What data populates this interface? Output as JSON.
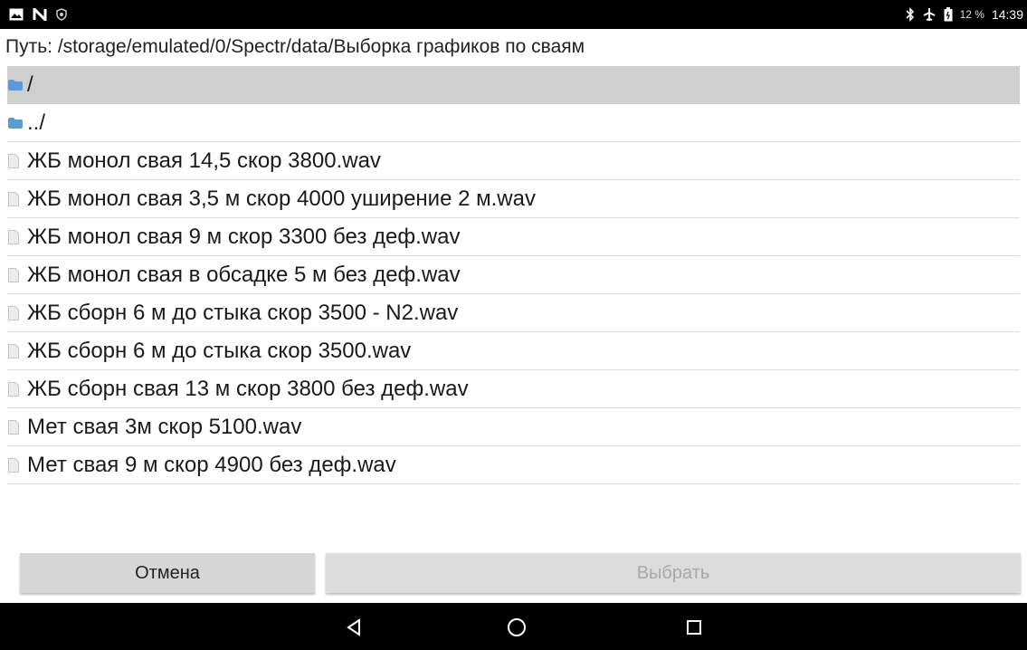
{
  "status_bar": {
    "battery_percent": "12 %",
    "time": "14:39",
    "left_icons": [
      "image-icon",
      "n-icon",
      "shield-icon"
    ],
    "right_icons": [
      "bluetooth-icon",
      "airplane-icon",
      "battery-icon"
    ]
  },
  "path_label": "Путь: /storage/emulated/0/Spectr/data/Выборка графиков по сваям",
  "items": [
    {
      "label": "/",
      "icon": "folder-icon",
      "selected": true
    },
    {
      "label": "../",
      "icon": "folder-icon",
      "selected": false
    },
    {
      "label": "ЖБ монол свая 14,5 скор 3800.wav",
      "icon": "file-icon",
      "selected": false
    },
    {
      "label": "ЖБ монол свая 3,5 м скор 4000 уширение 2 м.wav",
      "icon": "file-icon",
      "selected": false
    },
    {
      "label": "ЖБ монол свая 9 м скор 3300 без деф.wav",
      "icon": "file-icon",
      "selected": false
    },
    {
      "label": "ЖБ монол свая в обсадке 5 м без деф.wav",
      "icon": "file-icon",
      "selected": false
    },
    {
      "label": "ЖБ сборн 6 м до стыка скор 3500 - N2.wav",
      "icon": "file-icon",
      "selected": false
    },
    {
      "label": "ЖБ сборн 6 м до стыка скор 3500.wav",
      "icon": "file-icon",
      "selected": false
    },
    {
      "label": "ЖБ сборн свая 13 м скор 3800 без деф.wav",
      "icon": "file-icon",
      "selected": false
    },
    {
      "label": "Мет свая 3м скор 5100.wav",
      "icon": "file-icon",
      "selected": false
    },
    {
      "label": "Мет свая 9 м скор 4900 без деф.wav",
      "icon": "file-icon",
      "selected": false
    }
  ],
  "buttons": {
    "cancel_label": "Отмена",
    "select_label": "Выбрать",
    "select_enabled": false
  },
  "nav_bar": {
    "icons": [
      "back-icon",
      "home-icon",
      "recents-icon"
    ]
  },
  "colors": {
    "folder": "#5b9bd5",
    "selected_row": "#cfcfcf",
    "button_bg": "#d6d6d6",
    "disabled_text": "#a8a8a8"
  }
}
